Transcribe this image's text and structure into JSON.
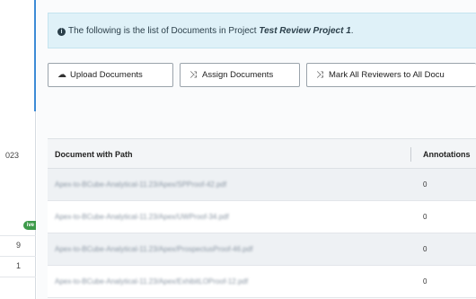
{
  "sidebar": {
    "partial_year": "023",
    "badge": "ive",
    "counts": [
      "9",
      "1"
    ]
  },
  "info": {
    "icon": "info-circle-icon",
    "prefix": "The following is the list of Documents in Project ",
    "project_name": "Test Review Project 1",
    "suffix": "."
  },
  "toolbar": {
    "upload_label": "Upload Documents",
    "upload_icon": "cloud-upload-icon",
    "assign_label": "Assign Documents",
    "assign_icon": "shuffle-icon",
    "mark_label": "Mark All Reviewers to All Docu",
    "mark_icon": "shuffle-icon"
  },
  "table": {
    "columns": [
      "Document with Path",
      "Annotations"
    ],
    "rows": [
      {
        "path": "Apex-to-BCube-Analytical-11.23/Apex/SPProof-42.pdf",
        "annotations": "0"
      },
      {
        "path": "Apex-to-BCube-Analytical-11.23/Apex/UWProof-34.pdf",
        "annotations": "0"
      },
      {
        "path": "Apex-to-BCube-Analytical-11.23/Apex/ProspectusProof-46.pdf",
        "annotations": "0"
      },
      {
        "path": "Apex-to-BCube-Analytical-11.23/Apex/ExhibitLOProof-12.pdf",
        "annotations": "0"
      }
    ]
  }
}
